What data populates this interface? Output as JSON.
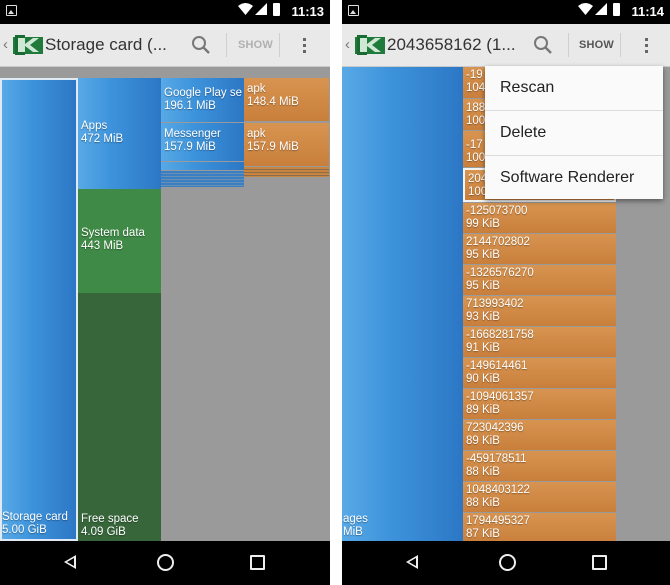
{
  "left": {
    "status": {
      "time": "11:13"
    },
    "actionbar": {
      "back_glyph": "‹",
      "title": "Storage card (...",
      "show_label": "SHOW",
      "icons": [
        "app-logo-icon",
        "search-icon",
        "overflow-menu-icon"
      ]
    },
    "treemap": {
      "root": {
        "name": "Storage card",
        "size": "5.00 GiB"
      },
      "apps": {
        "name": "Apps",
        "size": "472 MiB"
      },
      "system": {
        "name": "System data",
        "size": "443 MiB"
      },
      "free": {
        "name": "Free space",
        "size": "4.09 GiB"
      },
      "gplay": {
        "name": "Google Play se",
        "size": "196.1 MiB"
      },
      "messenger": {
        "name": "Messenger",
        "size": "157.9 MiB"
      },
      "apk1": {
        "name": "apk",
        "size": "148.4 MiB"
      },
      "apk2": {
        "name": "apk",
        "size": "157.9 MiB"
      }
    }
  },
  "right": {
    "status": {
      "time": "11:14"
    },
    "actionbar": {
      "back_glyph": "‹",
      "title": "2043658162 (1...",
      "show_label": "SHOW",
      "icons": [
        "app-logo-icon",
        "search-icon",
        "overflow-menu-icon"
      ]
    },
    "treemap": {
      "left_block": {
        "name": "ages",
        "size": "MiB"
      },
      "hidden_items": [
        {
          "name": "-19",
          "size": "104"
        },
        {
          "name": "188",
          "size": "100"
        },
        {
          "name": "-17",
          "size": "100"
        },
        {
          "name": "204",
          "size": "100"
        }
      ],
      "items": [
        {
          "name": "-125073700",
          "size": "99 KiB"
        },
        {
          "name": "2144702802",
          "size": "95 KiB"
        },
        {
          "name": "-1326576270",
          "size": "95 KiB"
        },
        {
          "name": "713993402",
          "size": "93 KiB"
        },
        {
          "name": "-1668281758",
          "size": "91 KiB"
        },
        {
          "name": "-149614461",
          "size": "90 KiB"
        },
        {
          "name": "-1094061357",
          "size": "89 KiB"
        },
        {
          "name": "723042396",
          "size": "89 KiB"
        },
        {
          "name": "-459178511",
          "size": "88 KiB"
        },
        {
          "name": "1048403122",
          "size": "88 KiB"
        },
        {
          "name": "1794495327",
          "size": "87 KiB"
        }
      ]
    },
    "menu": {
      "items": [
        "Rescan",
        "Delete",
        "Software Renderer"
      ]
    }
  },
  "colors": {
    "blue": "#3d93db",
    "green": "#3f8343",
    "orange": "#d08a46",
    "gray": "#9a9a9a"
  }
}
